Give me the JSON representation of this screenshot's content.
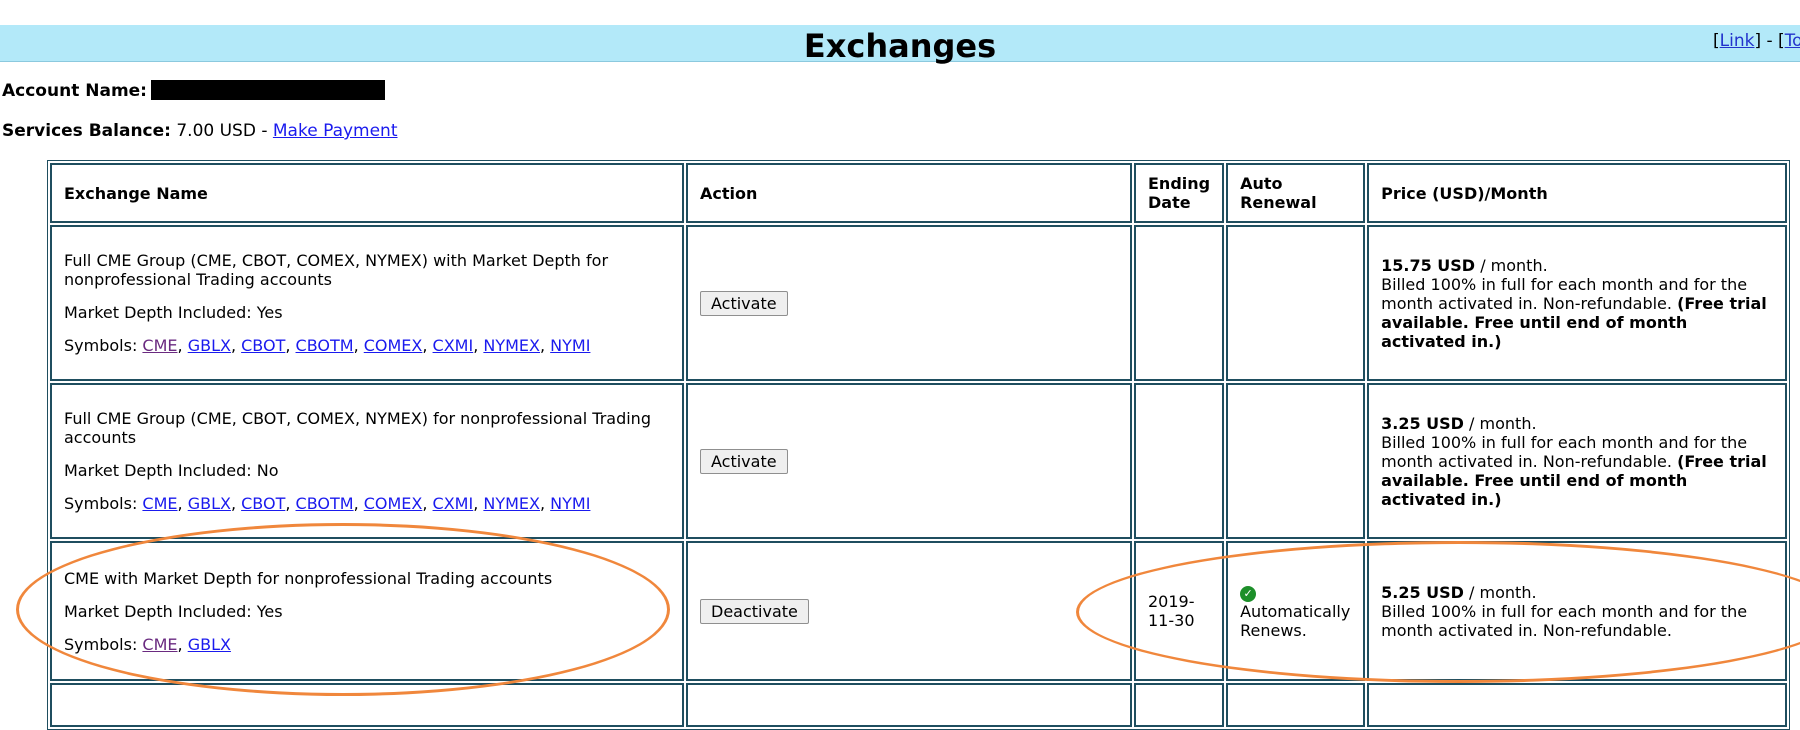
{
  "header": {
    "title": "Exchanges",
    "links_prefix": "[",
    "link_label": "Link",
    "links_sep": "] - [",
    "link2_label": "To"
  },
  "account": {
    "label": "Account Name:"
  },
  "balance": {
    "label": "Services Balance:",
    "value": "7.00 USD -",
    "payment_link": "Make Payment"
  },
  "table": {
    "headers": {
      "name": "Exchange Name",
      "action": "Action",
      "ending": "Ending Date",
      "renewal": "Auto Renewal",
      "price": "Price (USD)/Month"
    },
    "symbols_label": "Symbols:",
    "rows": [
      {
        "name": "Full CME Group (CME, CBOT, COMEX, NYMEX) with Market Depth for nonprofessional Trading accounts",
        "depth": "Market Depth Included: Yes",
        "symbols": [
          "CME",
          "GBLX",
          "CBOT",
          "CBOTM",
          "COMEX",
          "CXMI",
          "NYMEX",
          "NYMI"
        ],
        "action": "Activate",
        "ending": "",
        "renewal": "",
        "price_amount": "15.75 USD",
        "price_unit": "/ month.",
        "price_note": "Billed 100% in full for each month and for the month activated in. Non-refundable.",
        "price_trial": "(Free trial available. Free until end of month activated in.)"
      },
      {
        "name": "Full CME Group (CME, CBOT, COMEX, NYMEX) for nonprofessional Trading accounts",
        "depth": "Market Depth Included: No",
        "symbols": [
          "CME",
          "GBLX",
          "CBOT",
          "CBOTM",
          "COMEX",
          "CXMI",
          "NYMEX",
          "NYMI"
        ],
        "action": "Activate",
        "ending": "",
        "renewal": "",
        "price_amount": "3.25 USD",
        "price_unit": "/ month.",
        "price_note": "Billed 100% in full for each month and for the month activated in. Non-refundable.",
        "price_trial": "(Free trial available. Free until end of month activated in.)"
      },
      {
        "name": "CME with Market Depth for nonprofessional Trading accounts",
        "depth": "Market Depth Included: Yes",
        "symbols": [
          "CME",
          "GBLX"
        ],
        "action": "Deactivate",
        "ending": "2019-11-30",
        "renewal_icon": "check-circle-icon",
        "renewal": "Automatically Renews.",
        "price_amount": "5.25 USD",
        "price_unit": "/ month.",
        "price_note": "Billed 100% in full for each month and for the month activated in. Non-refundable."
      }
    ]
  },
  "colors": {
    "header_bg": "#b3e9f9",
    "table_border": "#1f4e5f",
    "annotation": "#f0873c",
    "link": "#1a1aee",
    "visited_link": "#6a2a80"
  }
}
